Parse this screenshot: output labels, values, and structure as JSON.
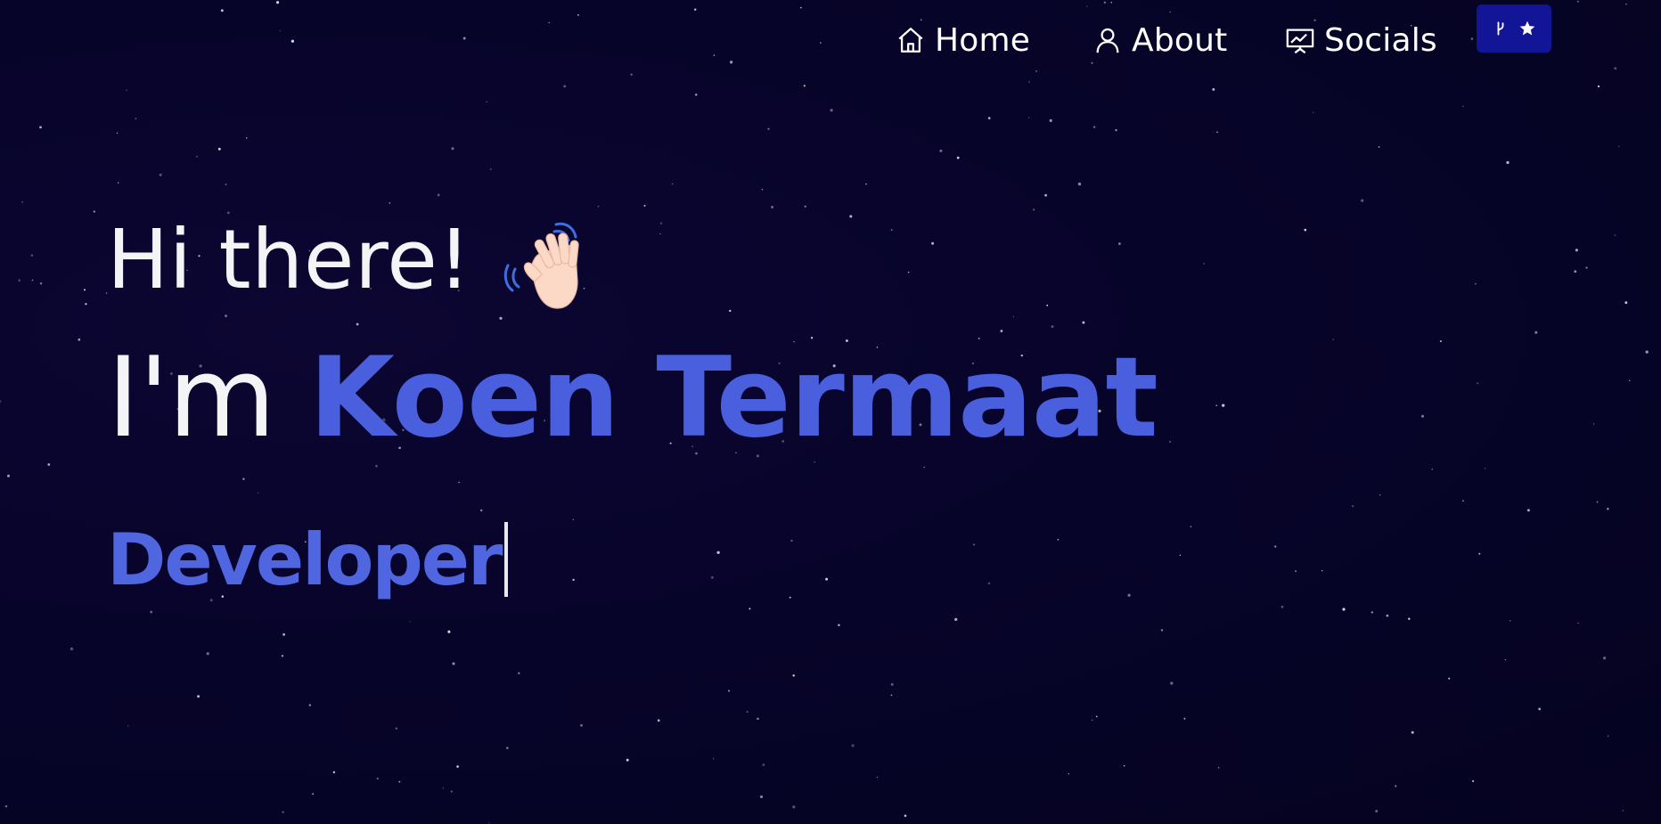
{
  "nav": {
    "home_label": "Home",
    "about_label": "About",
    "socials_label": "Socials"
  },
  "hero": {
    "greeting": "Hi there!",
    "intro_prefix": "I'm",
    "name": "Koen Termaat",
    "role": "Developer"
  },
  "colors": {
    "background": "#07042a",
    "accent": "#4a5fdd",
    "button": "#121696",
    "text": "#f4f4f7"
  },
  "icons": {
    "home": "home-icon",
    "about": "user-icon",
    "socials": "presentation-chart-icon",
    "fork": "git-fork-icon",
    "star": "star-icon",
    "wave": "waving-hand-icon"
  }
}
